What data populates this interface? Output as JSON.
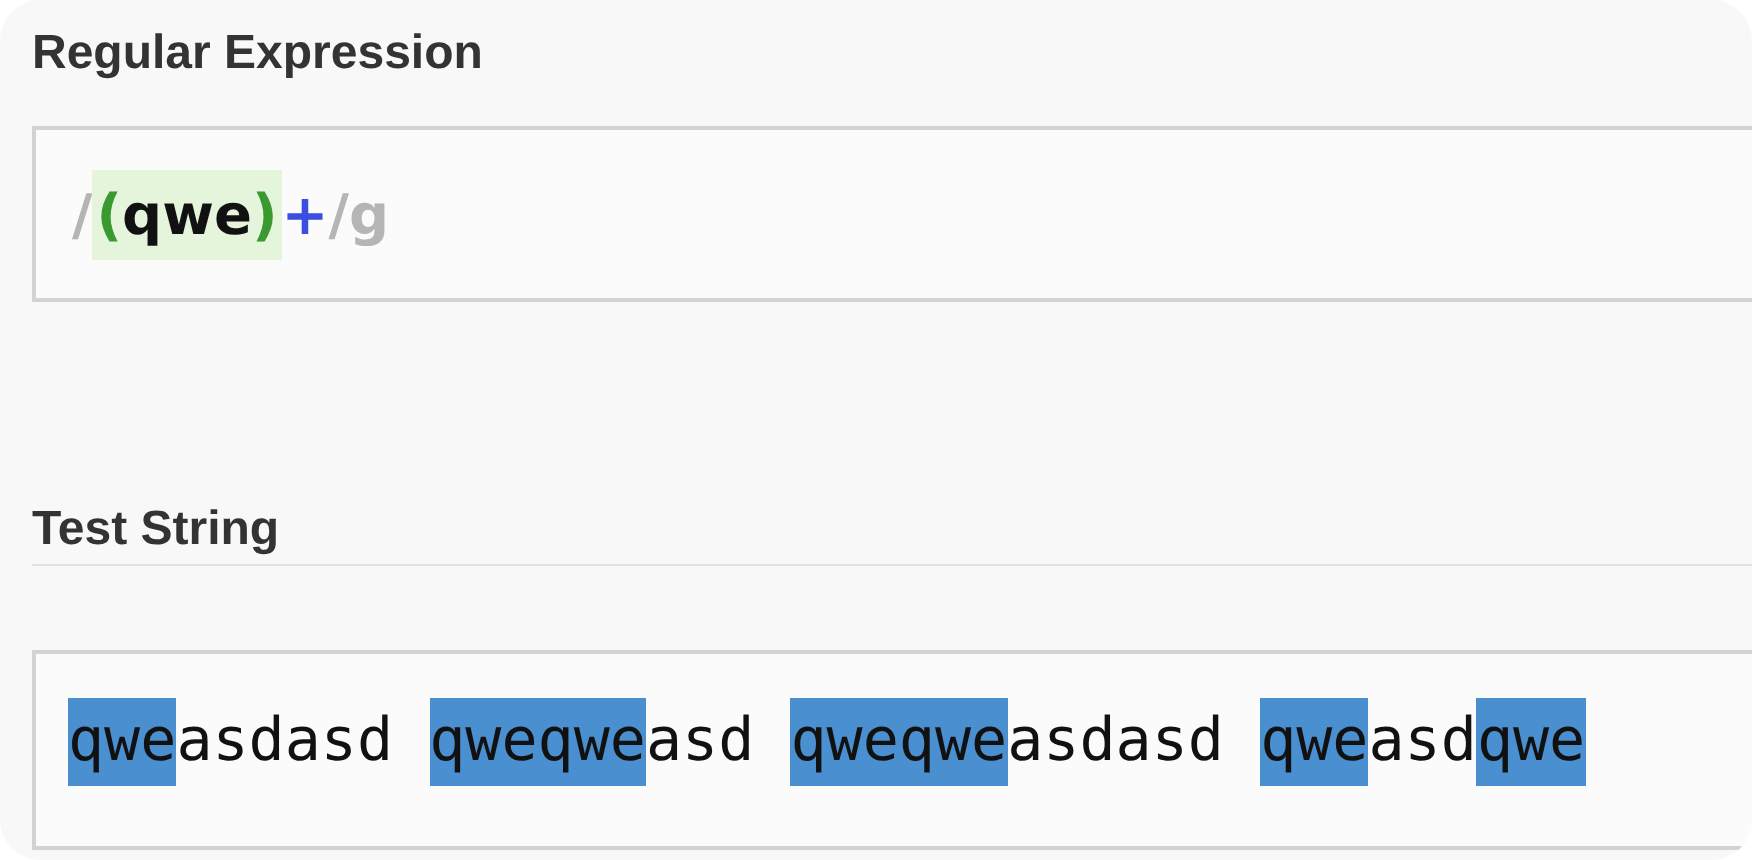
{
  "regex_section": {
    "title": "Regular Expression",
    "tokens": [
      {
        "kind": "delimiter",
        "text": "/"
      },
      {
        "kind": "group",
        "children": [
          {
            "kind": "paren",
            "text": "("
          },
          {
            "kind": "literal",
            "text": "qwe"
          },
          {
            "kind": "paren",
            "text": ")"
          }
        ]
      },
      {
        "kind": "quantifier",
        "text": "+"
      },
      {
        "kind": "delimiter",
        "text": "/"
      },
      {
        "kind": "flag",
        "text": "g"
      }
    ]
  },
  "test_section": {
    "title": "Test String",
    "segments": [
      {
        "text": "qwe",
        "match": true
      },
      {
        "text": "asdasd ",
        "match": false
      },
      {
        "text": "qweqwe",
        "match": true
      },
      {
        "text": "asd ",
        "match": false
      },
      {
        "text": "qweqwe",
        "match": true
      },
      {
        "text": "asdasd ",
        "match": false
      },
      {
        "text": "qwe",
        "match": true
      },
      {
        "text": "asd",
        "match": false
      },
      {
        "text": "qwe",
        "match": true
      }
    ]
  }
}
